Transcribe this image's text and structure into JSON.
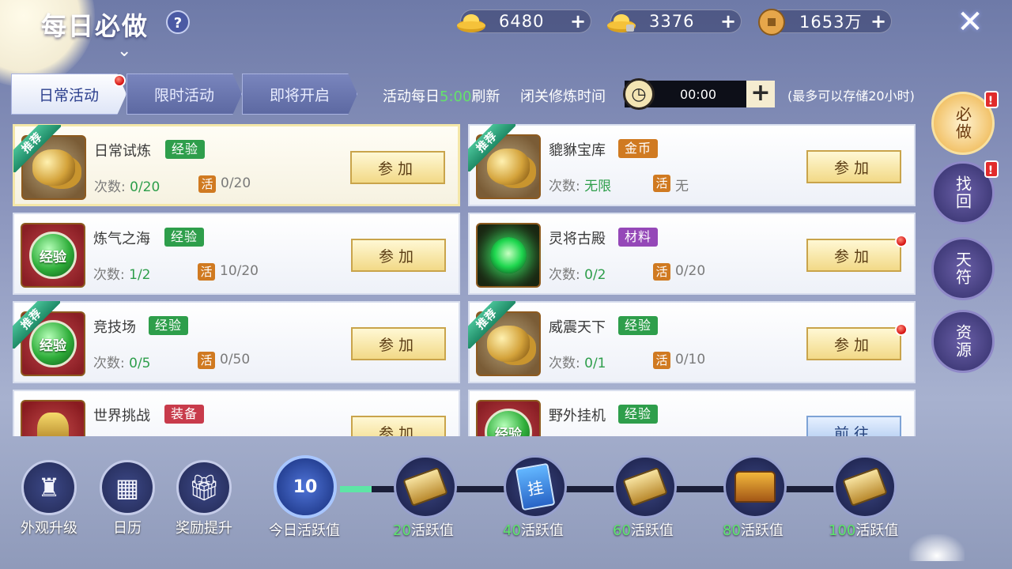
{
  "header": {
    "title": "每日必做",
    "help": "?",
    "currencies": [
      {
        "icon": "gold-ingot-icon",
        "value": "6480",
        "plus": "+"
      },
      {
        "icon": "bound-ingot-icon",
        "value": "3376",
        "plus": "+"
      },
      {
        "icon": "copper-coin-icon",
        "value": "1653万",
        "plus": "+"
      }
    ],
    "close": "✕"
  },
  "tabs": [
    {
      "label": "日常活动",
      "active": true
    },
    {
      "label": "限时活动",
      "active": false
    },
    {
      "label": "即将开启",
      "active": false
    }
  ],
  "info": {
    "refresh_prefix": "活动每日",
    "refresh_time": "5:00",
    "refresh_suffix": "刷新",
    "cultivation_label": "闭关修炼时间",
    "timer": "00:00",
    "timer_plus": "+",
    "storage_note": "(最多可以存储20小时)"
  },
  "labels": {
    "count_prefix": "次数:",
    "huo": "活",
    "recommend": "推荐",
    "join": "参加",
    "go": "前往"
  },
  "activities": [
    {
      "name": "日常试炼",
      "tag": "经验",
      "count": "0/20",
      "huo": "0/20",
      "recommend": true,
      "icon": "coins"
    },
    {
      "name": "貔貅宝库",
      "tag": "金币",
      "count": "无限",
      "huo": "无",
      "recommend": true,
      "icon": "coins"
    },
    {
      "name": "炼气之海",
      "tag": "经验",
      "count": "1/2",
      "huo": "10/20",
      "recommend": false,
      "icon": "exp"
    },
    {
      "name": "灵将古殿",
      "tag": "材料",
      "count": "0/2",
      "huo": "0/20",
      "recommend": false,
      "icon": "green"
    },
    {
      "name": "竞技场",
      "tag": "经验",
      "count": "0/5",
      "huo": "0/50",
      "recommend": true,
      "icon": "exp"
    },
    {
      "name": "威震天下",
      "tag": "经验",
      "count": "0/1",
      "huo": "0/10",
      "recommend": true,
      "icon": "coins"
    },
    {
      "name": "世界挑战",
      "tag": "装备",
      "recommend": false,
      "icon": "equip"
    },
    {
      "name": "野外挂机",
      "tag": "经验",
      "recommend": false,
      "icon": "exp"
    }
  ],
  "side_buttons": [
    "必做",
    "找回",
    "天符",
    "资源"
  ],
  "bottom_buttons": [
    {
      "label": "外观升级",
      "icon": "appearance-icon"
    },
    {
      "label": "日历",
      "icon": "calendar-icon"
    },
    {
      "label": "奖励提升",
      "icon": "gift-icon"
    }
  ],
  "activity": {
    "today_value": "10",
    "today_label": "今日活跃值",
    "progress_fraction": 0.06,
    "milestones": [
      {
        "num": "20",
        "suffix": "活跃值",
        "icon": "scroll"
      },
      {
        "num": "40",
        "suffix": "活跃值",
        "icon": "card",
        "icon_text": "挂"
      },
      {
        "num": "60",
        "suffix": "活跃值",
        "icon": "scroll"
      },
      {
        "num": "80",
        "suffix": "活跃值",
        "icon": "chest"
      },
      {
        "num": "100",
        "suffix": "活跃值",
        "icon": "scroll"
      }
    ]
  }
}
